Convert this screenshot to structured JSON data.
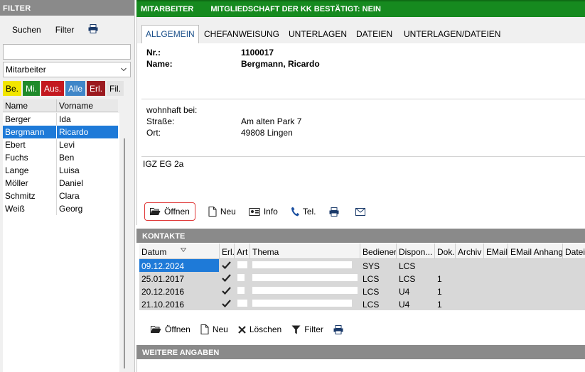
{
  "filter": {
    "title": "FILTER",
    "toolbar": {
      "search_label": "Suchen",
      "filter_label": "Filter"
    },
    "search_value": "",
    "select_value": "Mitarbeiter",
    "chips": [
      {
        "label": "Be.",
        "bg": "#f2e600",
        "fg": "#000"
      },
      {
        "label": "Mi.",
        "bg": "#1f8a2a",
        "fg": "#fff"
      },
      {
        "label": "Aus.",
        "bg": "#c3181f",
        "fg": "#fff"
      },
      {
        "label": "Alle",
        "bg": "#3f86c8",
        "fg": "#fff"
      },
      {
        "label": "Erl.",
        "bg": "#9b1a1f",
        "fg": "#fff"
      },
      {
        "label": "Fil.",
        "bg": "#e3e3e3",
        "fg": "#000"
      }
    ],
    "list_headers": {
      "name": "Name",
      "vorname": "Vorname"
    },
    "rows": [
      {
        "name": "Berger",
        "vorname": "Ida"
      },
      {
        "name": "Bergmann",
        "vorname": "Ricardo"
      },
      {
        "name": "Ebert",
        "vorname": "Levi"
      },
      {
        "name": "Fuchs",
        "vorname": "Ben"
      },
      {
        "name": "Lange",
        "vorname": "Luisa"
      },
      {
        "name": "Möller",
        "vorname": "Daniel"
      },
      {
        "name": "Schmitz",
        "vorname": "Clara"
      },
      {
        "name": "Weiß",
        "vorname": "Georg"
      }
    ],
    "selected_index": 1
  },
  "main": {
    "header_title": "MITARBEITER",
    "header_status": "MITGLIEDSCHAFT DER KK BESTÄTIGT: NEIN",
    "tabs": [
      "ALLGEMEIN",
      "CHEFANWEISUNG",
      "UNTERLAGEN",
      "DATEIEN",
      "UNTERLAGEN/DATEIEN"
    ],
    "active_tab": 0,
    "nr_label": "Nr.:",
    "nr_value": "1100017",
    "name_label": "Name:",
    "name_value": "Bergmann, Ricardo",
    "wohnhaft_label": "wohnhaft bei:",
    "strasse_label": "Straße:",
    "strasse_value": "Am alten Park 7",
    "ort_label": "Ort:",
    "ort_value": "49808 Lingen",
    "note": "IGZ EG 2a",
    "actions": {
      "open": "Öffnen",
      "new": "Neu",
      "info": "Info",
      "tel": "Tel."
    }
  },
  "kontakte": {
    "title": "KONTAKTE",
    "columns": [
      "Datum",
      "Erl.",
      "Art",
      "Thema",
      "Bediener",
      "Dispon...",
      "Dok.",
      "Archiv",
      "EMail",
      "EMail Anhang",
      "Datei"
    ],
    "rows": [
      {
        "datum": "09.12.2024",
        "erl": true,
        "art": "",
        "thema": "",
        "bediener": "SYS",
        "dispon": "LCS",
        "dok": ""
      },
      {
        "datum": "25.01.2017",
        "erl": true,
        "art": "",
        "thema": "",
        "bediener": "LCS",
        "dispon": "LCS",
        "dok": "1"
      },
      {
        "datum": "20.12.2016",
        "erl": true,
        "art": "",
        "thema": "",
        "bediener": "LCS",
        "dispon": "U4",
        "dok": "1"
      },
      {
        "datum": "21.10.2016",
        "erl": true,
        "art": "",
        "thema": "",
        "bediener": "LCS",
        "dispon": "U4",
        "dok": "1"
      }
    ],
    "toolbar": {
      "open": "Öffnen",
      "new": "Neu",
      "delete": "Löschen",
      "filter": "Filter"
    }
  },
  "weitere": {
    "title": "WEITERE ANGABEN"
  }
}
